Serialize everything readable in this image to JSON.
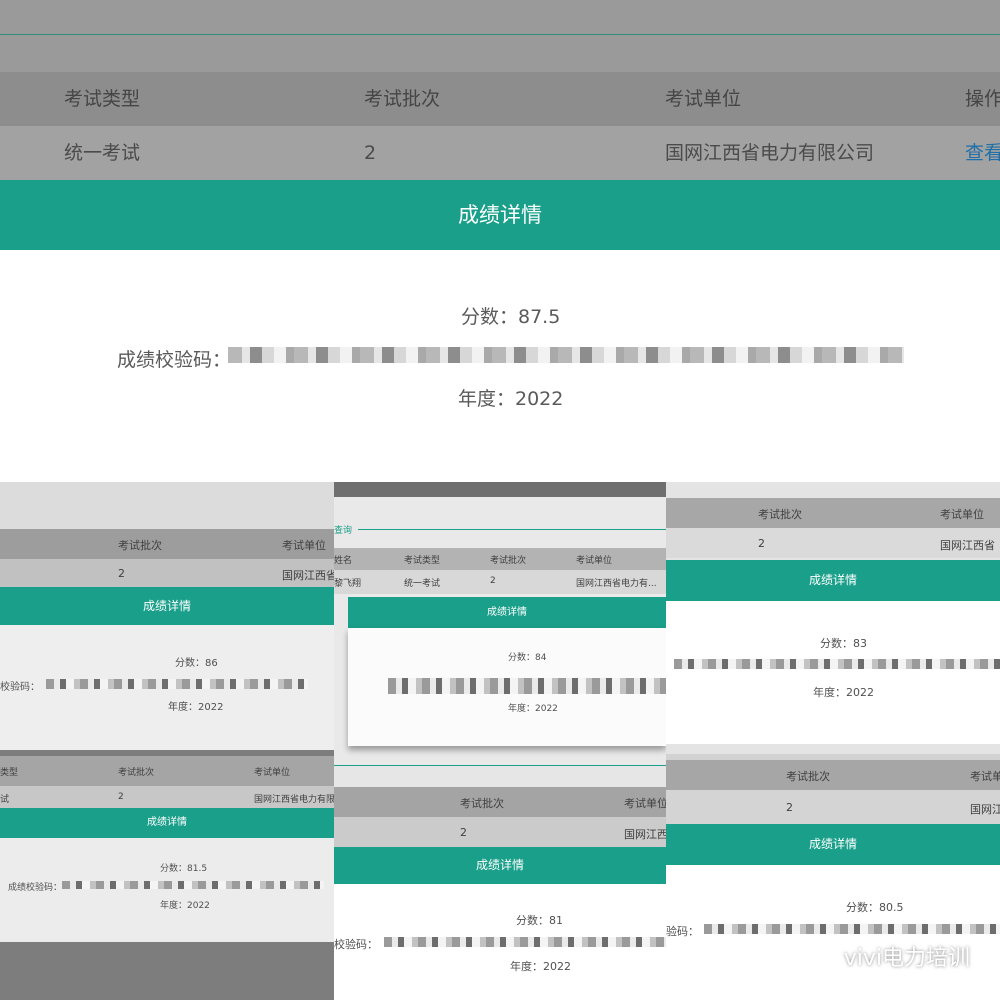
{
  "main": {
    "headers": [
      "考试类型",
      "考试批次",
      "考试单位",
      "操作"
    ],
    "row": [
      "统一考试",
      "2",
      "国网江西省电力有限公司",
      "查看"
    ],
    "modal_title": "成绩详情",
    "score_label": "分数：87.5",
    "check_label": "成绩校验码：",
    "year_label": "年度：2022"
  },
  "thumbs": {
    "a": {
      "h1": "考试批次",
      "h2": "考试单位",
      "r1": "2",
      "r2": "国网江西省",
      "title": "成绩详情",
      "score": "分数：86",
      "check": "校验码：",
      "year": "年度：2022"
    },
    "b": {
      "query": "查询",
      "h0": "姓名",
      "h1": "考试类型",
      "h2": "考试批次",
      "h3": "考试单位",
      "r0": "黎飞翔",
      "r1": "统一考试",
      "r2": "2",
      "r3": "国网江西省电力有...",
      "title": "成绩详情",
      "score": "分数：84",
      "year": "年度：2022"
    },
    "c": {
      "h1": "考试批次",
      "h2": "考试单位",
      "r1": "2",
      "r2": "国网江西省",
      "title": "成绩详情",
      "score": "分数：83",
      "year": "年度：2022"
    },
    "d": {
      "h0": "类型",
      "h1": "考试批次",
      "h2": "考试单位",
      "r0": "试",
      "r1": "2",
      "r2": "国网江西省电力有限公",
      "title": "成绩详情",
      "score": "分数：81.5",
      "check": "成绩校验码：",
      "year": "年度：2022"
    },
    "e": {
      "h1": "考试批次",
      "h2": "考试单位",
      "r1": "2",
      "r2": "国网江西",
      "title": "成绩详情",
      "score": "分数：81",
      "check": "校验码：",
      "year": "年度：2022"
    },
    "f": {
      "h1": "考试批次",
      "h2": "考试单",
      "r1": "2",
      "r2": "国网江",
      "title": "成绩详情",
      "score": "分数：80.5",
      "check": "验码："
    }
  },
  "watermark": "vivi电力培训",
  "colors": {
    "accent": "#1a9f8a",
    "link": "#1f6fa8"
  }
}
